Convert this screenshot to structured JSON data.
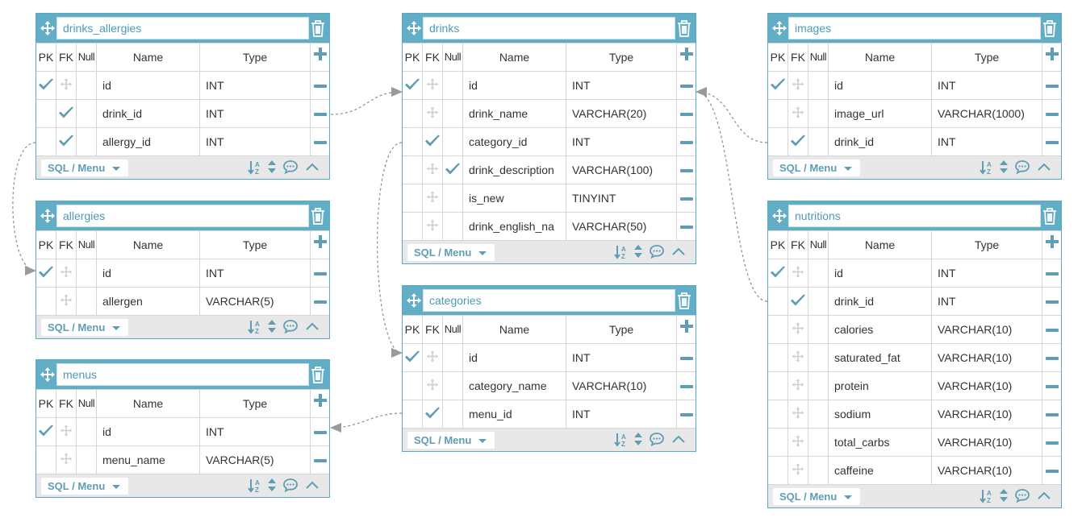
{
  "columns_header": {
    "pk": "PK",
    "fk": "FK",
    "null": "Null",
    "name": "Name",
    "type": "Type"
  },
  "footer_label": "SQL / Menu",
  "accent_color": "#62aec7",
  "check_color": "#5e9db3",
  "tables": {
    "drinks_allergies": {
      "title": "drinks_allergies",
      "rows": [
        {
          "name": "id",
          "type": "INT",
          "pk": true,
          "fk": false,
          "null": false
        },
        {
          "name": "drink_id",
          "type": "INT",
          "pk": false,
          "fk": true,
          "null": false
        },
        {
          "name": "allergy_id",
          "type": "INT",
          "pk": false,
          "fk": true,
          "null": false
        }
      ]
    },
    "allergies": {
      "title": "allergies",
      "rows": [
        {
          "name": "id",
          "type": "INT",
          "pk": true,
          "fk": false,
          "null": false
        },
        {
          "name": "allergen",
          "type": "VARCHAR(5)",
          "pk": false,
          "fk": false,
          "null": false
        }
      ]
    },
    "menus": {
      "title": "menus",
      "rows": [
        {
          "name": "id",
          "type": "INT",
          "pk": true,
          "fk": false,
          "null": false
        },
        {
          "name": "menu_name",
          "type": "VARCHAR(5)",
          "pk": false,
          "fk": false,
          "null": false
        }
      ]
    },
    "drinks": {
      "title": "drinks",
      "rows": [
        {
          "name": "id",
          "type": "INT",
          "pk": true,
          "fk": false,
          "null": false
        },
        {
          "name": "drink_name",
          "type": "VARCHAR(20)",
          "pk": false,
          "fk": false,
          "null": false
        },
        {
          "name": "category_id",
          "type": "INT",
          "pk": false,
          "fk": true,
          "null": false
        },
        {
          "name": "drink_description",
          "type": "VARCHAR(100)",
          "pk": false,
          "fk": false,
          "null": true
        },
        {
          "name": "is_new",
          "type": "TINYINT",
          "pk": false,
          "fk": false,
          "null": false
        },
        {
          "name": "drink_english_na",
          "type": "VARCHAR(50)",
          "pk": false,
          "fk": false,
          "null": false
        }
      ]
    },
    "categories": {
      "title": "categories",
      "rows": [
        {
          "name": "id",
          "type": "INT",
          "pk": true,
          "fk": false,
          "null": false
        },
        {
          "name": "category_name",
          "type": "VARCHAR(10)",
          "pk": false,
          "fk": false,
          "null": false
        },
        {
          "name": "menu_id",
          "type": "INT",
          "pk": false,
          "fk": true,
          "null": false
        }
      ]
    },
    "images": {
      "title": "images",
      "rows": [
        {
          "name": "id",
          "type": "INT",
          "pk": true,
          "fk": false,
          "null": false
        },
        {
          "name": "image_url",
          "type": "VARCHAR(1000)",
          "pk": false,
          "fk": false,
          "null": false
        },
        {
          "name": "drink_id",
          "type": "INT",
          "pk": false,
          "fk": true,
          "null": false
        }
      ]
    },
    "nutritions": {
      "title": "nutritions",
      "rows": [
        {
          "name": "id",
          "type": "INT",
          "pk": true,
          "fk": false,
          "null": false
        },
        {
          "name": "drink_id",
          "type": "INT",
          "pk": false,
          "fk": true,
          "null": false
        },
        {
          "name": "calories",
          "type": "VARCHAR(10)",
          "pk": false,
          "fk": false,
          "null": false
        },
        {
          "name": "saturated_fat",
          "type": "VARCHAR(10)",
          "pk": false,
          "fk": false,
          "null": false
        },
        {
          "name": "protein",
          "type": "VARCHAR(10)",
          "pk": false,
          "fk": false,
          "null": false
        },
        {
          "name": "sodium",
          "type": "VARCHAR(10)",
          "pk": false,
          "fk": false,
          "null": false
        },
        {
          "name": "total_carbs",
          "type": "VARCHAR(10)",
          "pk": false,
          "fk": false,
          "null": false
        },
        {
          "name": "caffeine",
          "type": "VARCHAR(10)",
          "pk": false,
          "fk": false,
          "null": false
        }
      ]
    }
  },
  "relations": [
    {
      "from": "drinks_allergies.drink_id",
      "to": "drinks.id"
    },
    {
      "from": "drinks_allergies.allergy_id",
      "to": "allergies.id"
    },
    {
      "from": "drinks.category_id",
      "to": "categories.id"
    },
    {
      "from": "categories.menu_id",
      "to": "menus.id"
    },
    {
      "from": "images.drink_id",
      "to": "drinks.id"
    },
    {
      "from": "nutritions.drink_id",
      "to": "drinks.id"
    }
  ]
}
